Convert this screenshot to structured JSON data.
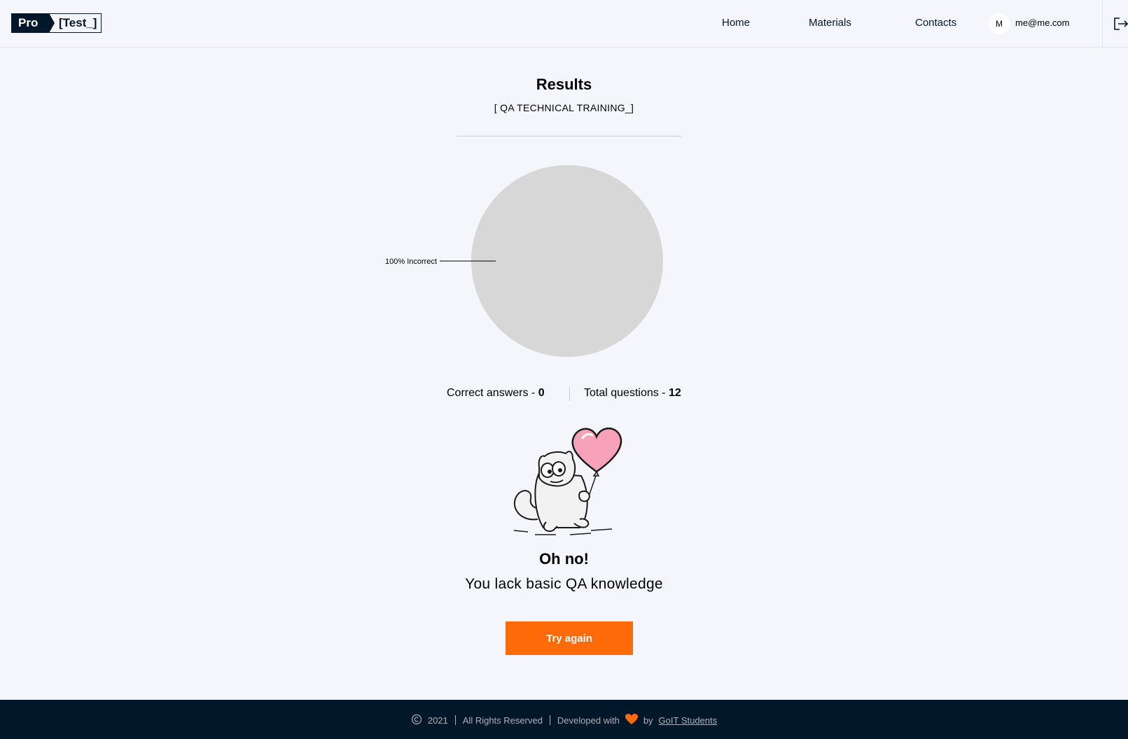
{
  "header": {
    "logo": {
      "pro": "Pro",
      "test": "[Test_]"
    },
    "nav": [
      {
        "label": "Home"
      },
      {
        "label": "Materials"
      },
      {
        "label": "Contacts"
      }
    ],
    "user": {
      "initial": "M",
      "email": "me@me.com"
    },
    "logout_icon": "logout-icon"
  },
  "main": {
    "title": "Results",
    "subtitle": "[ QA TECHNICAL TRAINING_]",
    "stats": {
      "correct_label": "Correct answers - ",
      "correct_value": "0",
      "total_label": "Total questions - ",
      "total_value": "12"
    },
    "illustration": "cat-with-heart-balloon",
    "result_title": "Oh no!",
    "result_text": "You lack basic QA knowledge",
    "try_again_label": "Try again"
  },
  "chart_data": {
    "type": "pie",
    "categories": [
      "Incorrect"
    ],
    "values": [
      100
    ],
    "data_labels": [
      "100% Incorrect"
    ],
    "colors": [
      "#d7d7d7"
    ]
  },
  "footer": {
    "copyright_icon": "copyright-icon",
    "year": "2021",
    "rights": "All Rights Reserved",
    "developed_with": "Developed with",
    "heart_icon": "heart-icon",
    "heart_color": "#ff6b09",
    "by": "by",
    "team": "GoIT Students"
  },
  "colors": {
    "accent": "#ff6b09",
    "dark": "#02172a",
    "background": "#f5f6fb"
  }
}
